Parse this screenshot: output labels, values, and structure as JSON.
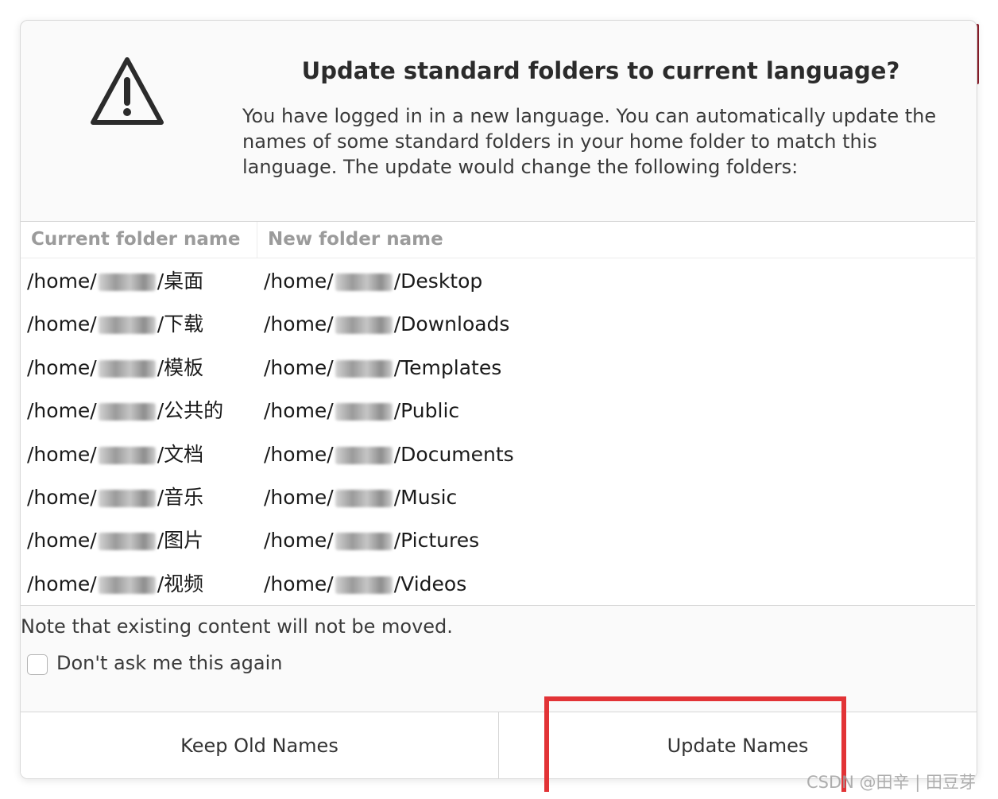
{
  "dialog": {
    "title": "Update standard folders to current language?",
    "message": "You have logged in in a new language. You can automatically update the names of some standard folders in your home folder to match this language. The update would change the following folders:",
    "icon": "warning-icon"
  },
  "table": {
    "headers": {
      "current": "Current folder name",
      "new": "New folder name"
    },
    "rows": [
      {
        "current_prefix": "/home/",
        "current_suffix": "/桌面",
        "new_prefix": "/home/",
        "new_suffix": "/Desktop"
      },
      {
        "current_prefix": "/home/",
        "current_suffix": "/下载",
        "new_prefix": "/home/",
        "new_suffix": "/Downloads"
      },
      {
        "current_prefix": "/home/",
        "current_suffix": "/模板",
        "new_prefix": "/home/",
        "new_suffix": "/Templates"
      },
      {
        "current_prefix": "/home/",
        "current_suffix": "/公共的",
        "new_prefix": "/home/",
        "new_suffix": "/Public"
      },
      {
        "current_prefix": "/home/",
        "current_suffix": "/文档",
        "new_prefix": "/home/",
        "new_suffix": "/Documents"
      },
      {
        "current_prefix": "/home/",
        "current_suffix": "/音乐",
        "new_prefix": "/home/",
        "new_suffix": "/Music"
      },
      {
        "current_prefix": "/home/",
        "current_suffix": "/图片",
        "new_prefix": "/home/",
        "new_suffix": "/Pictures"
      },
      {
        "current_prefix": "/home/",
        "current_suffix": "/视频",
        "new_prefix": "/home/",
        "new_suffix": "/Videos"
      }
    ]
  },
  "note": "Note that existing content will not be moved.",
  "checkbox": {
    "label": "Don't ask me this again",
    "checked": false
  },
  "buttons": {
    "keep": "Keep Old Names",
    "update": "Update Names"
  },
  "annotation": {
    "highlight_color": "#e23336"
  },
  "watermark": "CSDN @田辛 | 田豆芽"
}
